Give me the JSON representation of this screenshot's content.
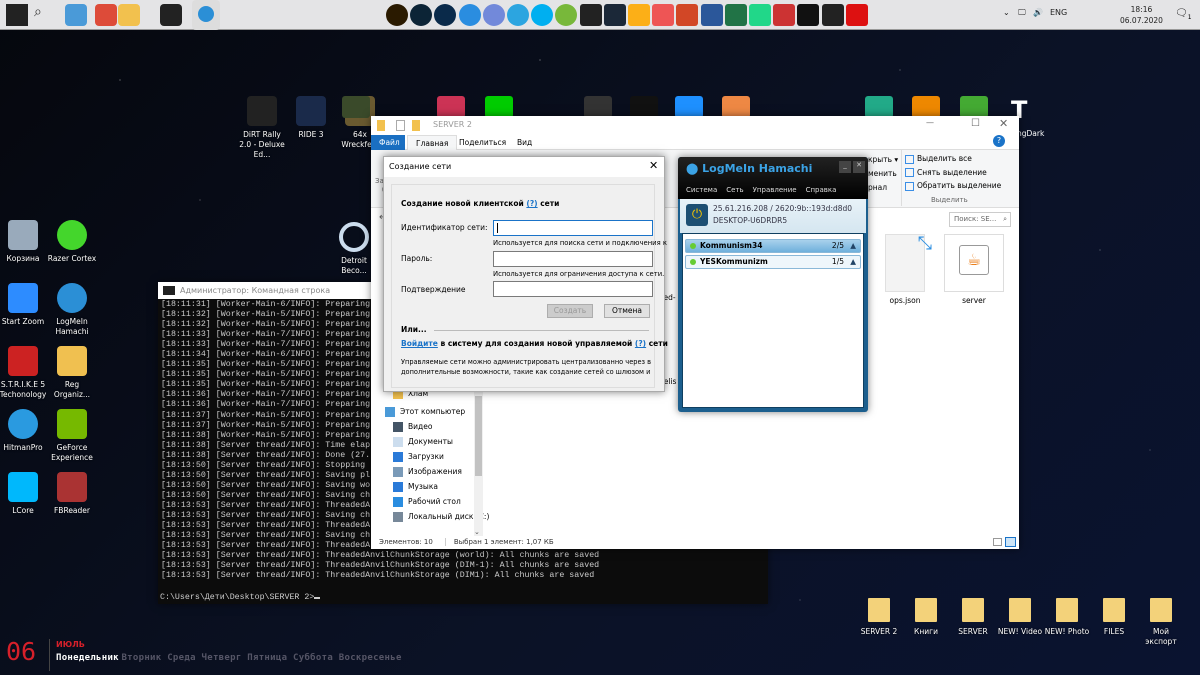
{
  "taskbar": {
    "pinned": [
      {
        "name": "start-icon",
        "color": "#222"
      },
      {
        "name": "search-icon",
        "color": "#555"
      },
      {
        "name": "this-pc-icon",
        "color": "#4a9ad8"
      },
      {
        "name": "chrome-icon",
        "color": "#dd4b39"
      },
      {
        "name": "file-explorer-icon",
        "color": "#f2c14e"
      },
      {
        "name": "cmd-icon",
        "color": "#222"
      },
      {
        "name": "hamachi-icon",
        "color": "#2b8fd6"
      }
    ],
    "apps": [
      {
        "name": "illustrator-icon",
        "color": "#2a1a00"
      },
      {
        "name": "lightroom-icon",
        "color": "#0c2436"
      },
      {
        "name": "photoshop-icon",
        "color": "#0a2a4a"
      },
      {
        "name": "app-blue-icon",
        "color": "#2a8de0"
      },
      {
        "name": "discord-icon",
        "color": "#7289da"
      },
      {
        "name": "telegram-icon",
        "color": "#2ca5e0"
      },
      {
        "name": "skype-icon",
        "color": "#00aff0"
      },
      {
        "name": "utorrent-icon",
        "color": "#78b83a"
      },
      {
        "name": "epic-games-icon",
        "color": "#222"
      },
      {
        "name": "steam-icon",
        "color": "#1b2838"
      },
      {
        "name": "rockstar-icon",
        "color": "#fcaf17"
      },
      {
        "name": "fps-monitor-icon",
        "color": "#e55"
      },
      {
        "name": "powerpoint-icon",
        "color": "#d24726"
      },
      {
        "name": "word-icon",
        "color": "#2b579a"
      },
      {
        "name": "excel-icon",
        "color": "#217346"
      },
      {
        "name": "pycharm-icon",
        "color": "#21d789"
      },
      {
        "name": "pdf24-icon",
        "color": "#c33"
      },
      {
        "name": "aura-icon",
        "color": "#111"
      },
      {
        "name": "nvidia-icon",
        "color": "#222"
      },
      {
        "name": "vegas-icon",
        "color": "#d11"
      }
    ],
    "lang": "ENG",
    "time": "18:16",
    "date": "06.07.2020",
    "notifications": "1"
  },
  "desktop": {
    "left_icons": [
      {
        "label": "Корзина",
        "color": "#9ab"
      },
      {
        "label": "Razer Cortex",
        "color": "#44d62c"
      },
      {
        "label": "Start Zoom",
        "color": "#2d8cff"
      },
      {
        "label": "LogMeIn Hamachi",
        "color": "#2b8fd6"
      },
      {
        "label": "S.T.R.I.K.E 5 Techonology",
        "color": "#c22"
      },
      {
        "label": "Reg Organiz...",
        "color": "#f0c050"
      },
      {
        "label": "HitmanPro",
        "color": "#2a9ae0"
      },
      {
        "label": "GeForce Experience",
        "color": "#76b900"
      },
      {
        "label": "LCore",
        "color": "#00b8fc"
      },
      {
        "label": "FBReader",
        "color": "#a33"
      }
    ],
    "top_icons": [
      {
        "label": "DiRT Rally 2.0 - Deluxe Ed...",
        "color": "#222"
      },
      {
        "label": "RIDE 3",
        "color": "#1a2a4a"
      },
      {
        "label": "64x Wreckfest",
        "color": "#6a5a30"
      }
    ],
    "detroit": "Detroit Beco...",
    "partial_label": "ngDark",
    "bottom_folders": [
      "SERVER 2",
      "Книги",
      "SERVER",
      "NEW! Video",
      "NEW! Photo",
      "FILES",
      "Мой экспорт"
    ]
  },
  "calendar": {
    "day": "06",
    "month": "ИЮЛЬ",
    "today": "Понедельник",
    "other_days": "Вторник Среда Четверг Пятница Суббота Воскресенье",
    "accent": "#d6202a"
  },
  "console": {
    "title": "Администратор: Командная строка",
    "lines": [
      "[18:11:31] [Worker-Main-6/INFO]: Preparing",
      "[18:11:32] [Worker-Main-5/INFO]: Preparing",
      "[18:11:32] [Worker-Main-5/INFO]: Preparing",
      "[18:11:33] [Worker-Main-7/INFO]: Preparing",
      "[18:11:33] [Worker-Main-7/INFO]: Preparing",
      "[18:11:34] [Worker-Main-6/INFO]: Preparing",
      "[18:11:35] [Worker-Main-5/INFO]: Preparing",
      "[18:11:35] [Worker-Main-5/INFO]: Preparing",
      "[18:11:35] [Worker-Main-5/INFO]: Preparing",
      "[18:11:36] [Worker-Main-7/INFO]: Preparing",
      "[18:11:36] [Worker-Main-7/INFO]: Preparing",
      "[18:11:37] [Worker-Main-5/INFO]: Preparing",
      "[18:11:37] [Worker-Main-5/INFO]: Preparing",
      "[18:11:38] [Worker-Main-5/INFO]: Preparing",
      "[18:11:38] [Server thread/INFO]: Time elap",
      "[18:11:38] [Server thread/INFO]: Done (27.",
      "[18:13:50] [Server thread/INFO]: Stopping",
      "[18:13:50] [Server thread/INFO]: Saving pl",
      "[18:13:50] [Server thread/INFO]: Saving wo",
      "[18:13:50] [Server thread/INFO]: Saving ch",
      "[18:13:53] [Server thread/INFO]: ThreadedA",
      "[18:13:53] [Server thread/INFO]: Saving ch",
      "[18:13:53] [Server thread/INFO]: ThreadedA",
      "[18:13:53] [Server thread/INFO]: Saving ch",
      "[18:13:53] [Server thread/INFO]: ThreadedA",
      "[18:13:53] [Server thread/INFO]: ThreadedAnvilChunkStorage (world): All chunks are saved",
      "[18:13:53] [Server thread/INFO]: ThreadedAnvilChunkStorage (DIM-1): All chunks are saved",
      "[18:13:53] [Server thread/INFO]: ThreadedAnvilChunkStorage (DIM1): All chunks are saved"
    ],
    "prompt": "C:\\Users\\Дети\\Desktop\\SERVER 2>"
  },
  "explorer": {
    "title": "SERVER 2",
    "tabs": [
      "Файл",
      "Главная",
      "Поделиться",
      "Вид"
    ],
    "ribbon_select": [
      "Выделить все",
      "Снять выделение",
      "Обратить выделение"
    ],
    "ribbon_select_group": "Выделить",
    "ribbon_partial": [
      "крыть ▾",
      "менить",
      "рнал"
    ],
    "ribbon_left_partial": [
      "Зак",
      "б"
    ],
    "search_placeholder": "Поиск: SE...",
    "nav": [
      "Хлам",
      "Этот компьютер",
      "Видео",
      "Документы",
      "Загрузки",
      "Изображения",
      "Музыка",
      "Рабочий стол",
      "Локальный диск (C:)"
    ],
    "files": [
      "ops.json",
      "server"
    ],
    "partial_files": [
      "nned-",
      "hitelis"
    ],
    "status_items": "Элементов: 10",
    "status_selected": "Выбран 1 элемент: 1,07 КБ"
  },
  "dialog": {
    "title": "Создание сети",
    "heading": "Создание новой клиентской",
    "help": "(?)",
    "heading_end": "сети",
    "id_label": "Идентификатор сети:",
    "id_value": "",
    "id_hint": "Используется для поиска сети и подключения к",
    "password_label": "Пароль:",
    "password_hint": "Используется для ограничения доступа к сети.",
    "confirm_label": "Подтверждение",
    "create": "Создать",
    "cancel": "Отмена",
    "or": "Или...",
    "login_link": "Войдите",
    "login_text": "в систему для создания новой управляемой",
    "login_end": "сети",
    "desc1": "Управляемые сети можно администрировать централизованно через веб-ин",
    "desc2": "дополнительные возможности, такие как создание сетей со шлюзом и сетей"
  },
  "hamachi": {
    "title": "LogMeIn Hamachi",
    "menu": [
      "Система",
      "Сеть",
      "Управление",
      "Справка"
    ],
    "address": "25.61.216.208 / 2620:9b::193d:d8d0",
    "hostname": "DESKTOP-U6DRDR5",
    "networks": [
      {
        "name": "Kommunism34",
        "count": "2/5",
        "selected": true
      },
      {
        "name": "YESKommunizm",
        "count": "1/5",
        "selected": false
      }
    ]
  }
}
